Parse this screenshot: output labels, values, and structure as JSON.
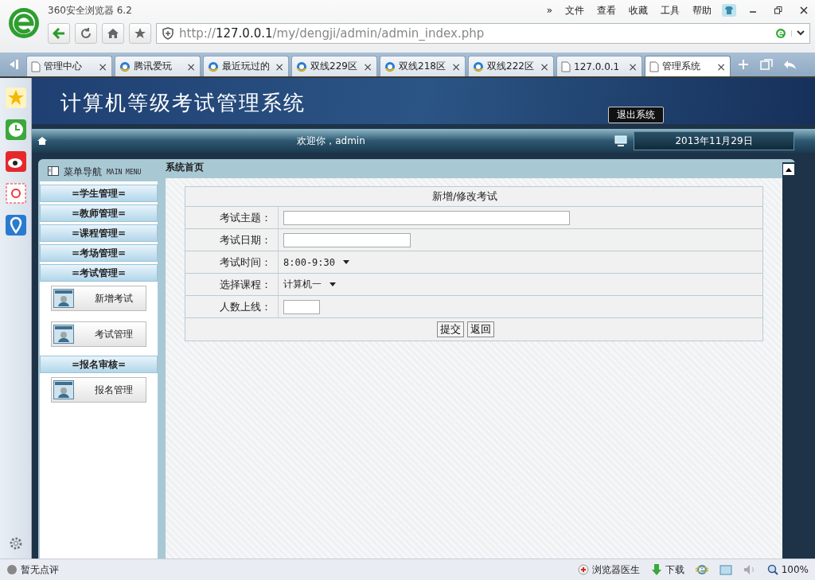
{
  "browser": {
    "title": "360安全浏览器 6.2",
    "menu": [
      "»",
      "文件",
      "查看",
      "收藏",
      "工具",
      "帮助"
    ],
    "address": {
      "scheme": "http://",
      "host": "127.0.0.1",
      "path": "/my/dengji/admin/admin_index.php"
    },
    "tabs": [
      {
        "label": "管理中心",
        "kind": "page",
        "selected": false
      },
      {
        "label": "腾讯爱玩",
        "kind": "globe",
        "selected": false
      },
      {
        "label": "最近玩过的",
        "kind": "globe",
        "selected": false
      },
      {
        "label": "双线229区",
        "kind": "globe",
        "selected": false
      },
      {
        "label": "双线218区",
        "kind": "globe",
        "selected": false
      },
      {
        "label": "双线222区",
        "kind": "globe",
        "selected": false
      },
      {
        "label": "127.0.0.1",
        "kind": "page",
        "selected": false
      },
      {
        "label": "管理系统",
        "kind": "page",
        "selected": true
      }
    ],
    "close_glyph": "×",
    "status": {
      "rating": "暂无点评",
      "doctor": "浏览器医生",
      "download": "下载",
      "zoom": "100%"
    }
  },
  "page": {
    "title": "计算机等级考试管理系统",
    "logout": "退出系统",
    "welcome": "欢迎你，admin",
    "date": "2013年11月29日",
    "menu_title": "菜单导航",
    "menu_subtitle": "MAIN MENU",
    "menu": [
      {
        "label": "=学生管理="
      },
      {
        "label": "=教师管理="
      },
      {
        "label": "=课程管理="
      },
      {
        "label": "=考场管理="
      },
      {
        "label": "=考试管理=",
        "children": [
          {
            "label": "新增考试"
          },
          {
            "label": "考试管理"
          }
        ]
      },
      {
        "label": "=报名审核=",
        "children": [
          {
            "label": "报名管理"
          }
        ]
      }
    ],
    "breadcrumb": "系统首页",
    "form": {
      "title": "新增/修改考试",
      "fields": [
        {
          "label": "考试主题：",
          "kind": "wide"
        },
        {
          "label": "考试日期：",
          "kind": "medium"
        },
        {
          "label": "考试时间：",
          "kind": "select",
          "value": "8:00-9:30"
        },
        {
          "label": "选择课程：",
          "kind": "select",
          "value": "计算机一"
        },
        {
          "label": "人数上线：",
          "kind": "small"
        }
      ],
      "buttons": [
        "提交",
        "返回"
      ]
    }
  }
}
